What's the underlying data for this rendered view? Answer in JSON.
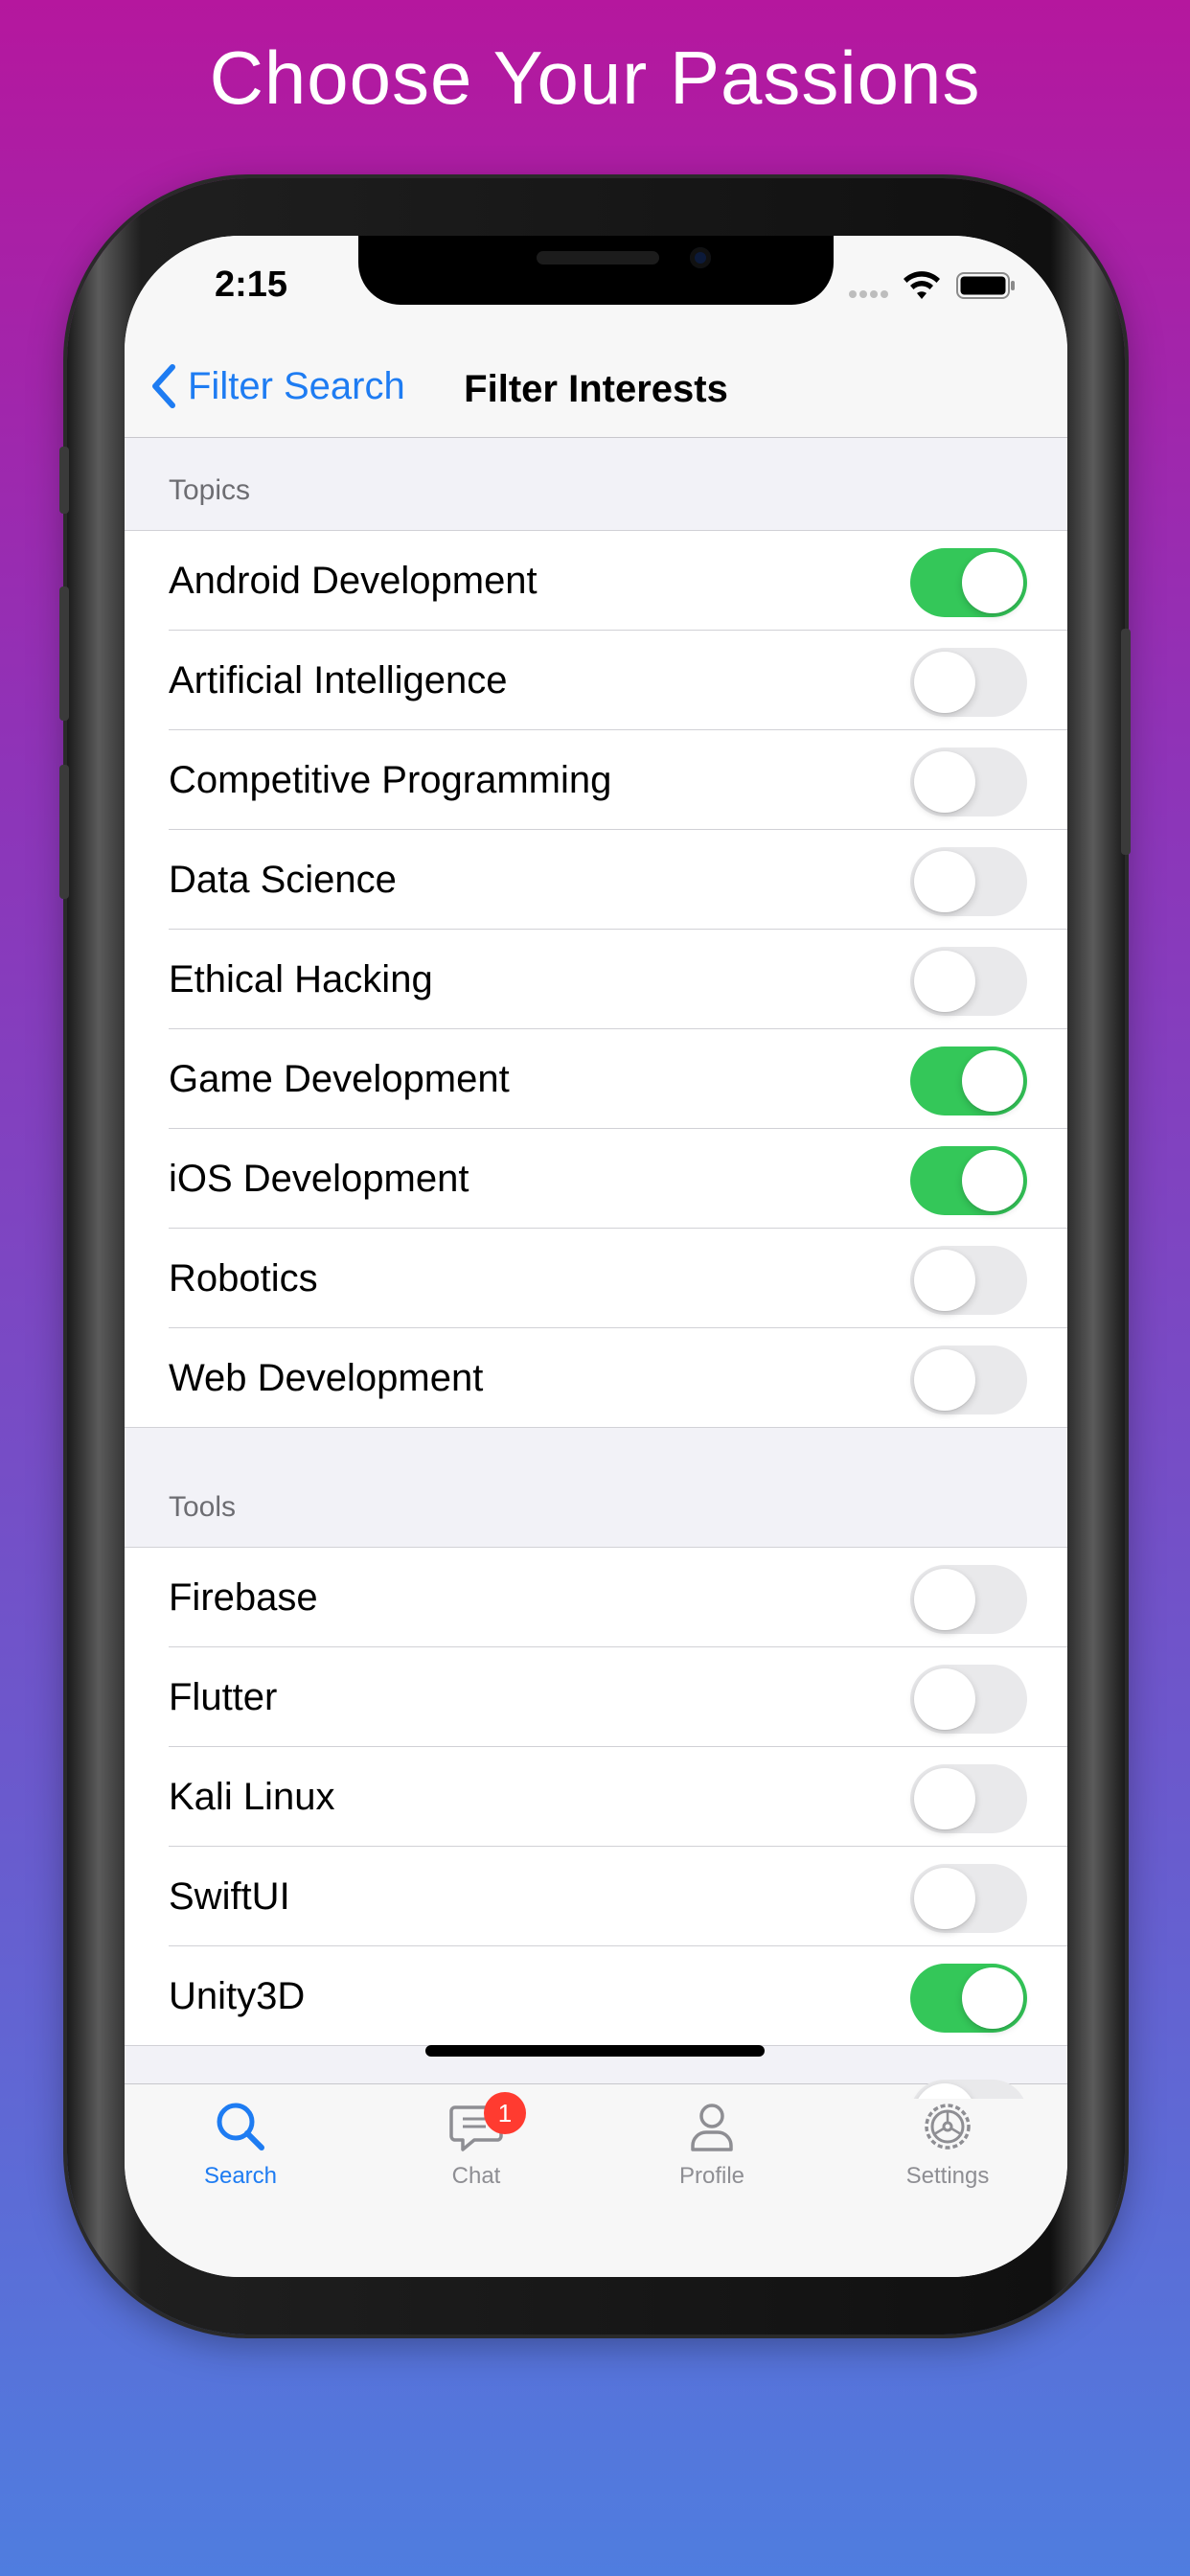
{
  "headline": "Choose Your Passions",
  "status_bar": {
    "time": "2:15"
  },
  "nav": {
    "back_label": "Filter Search",
    "title": "Filter Interests"
  },
  "sections": [
    {
      "header": "Topics",
      "items": [
        {
          "label": "Android Development",
          "on": true
        },
        {
          "label": "Artificial Intelligence",
          "on": false
        },
        {
          "label": "Competitive Programming",
          "on": false
        },
        {
          "label": "Data Science",
          "on": false
        },
        {
          "label": "Ethical Hacking",
          "on": false
        },
        {
          "label": "Game Development",
          "on": true
        },
        {
          "label": "iOS Development",
          "on": true
        },
        {
          "label": "Robotics",
          "on": false
        },
        {
          "label": "Web Development",
          "on": false
        }
      ]
    },
    {
      "header": "Tools",
      "items": [
        {
          "label": "Firebase",
          "on": false
        },
        {
          "label": "Flutter",
          "on": false
        },
        {
          "label": "Kali Linux",
          "on": false
        },
        {
          "label": "SwiftUI",
          "on": false
        },
        {
          "label": "Unity3D",
          "on": true
        }
      ]
    }
  ],
  "tab_bar": {
    "tabs": [
      {
        "label": "Search",
        "icon": "search-icon",
        "active": true
      },
      {
        "label": "Chat",
        "icon": "chat-icon",
        "active": false,
        "badge": "1"
      },
      {
        "label": "Profile",
        "icon": "person-icon",
        "active": false
      },
      {
        "label": "Settings",
        "icon": "gear-icon",
        "active": false
      }
    ]
  },
  "colors": {
    "accent": "#1e7cf2",
    "toggle_on": "#34c759",
    "badge": "#ff3b30"
  }
}
